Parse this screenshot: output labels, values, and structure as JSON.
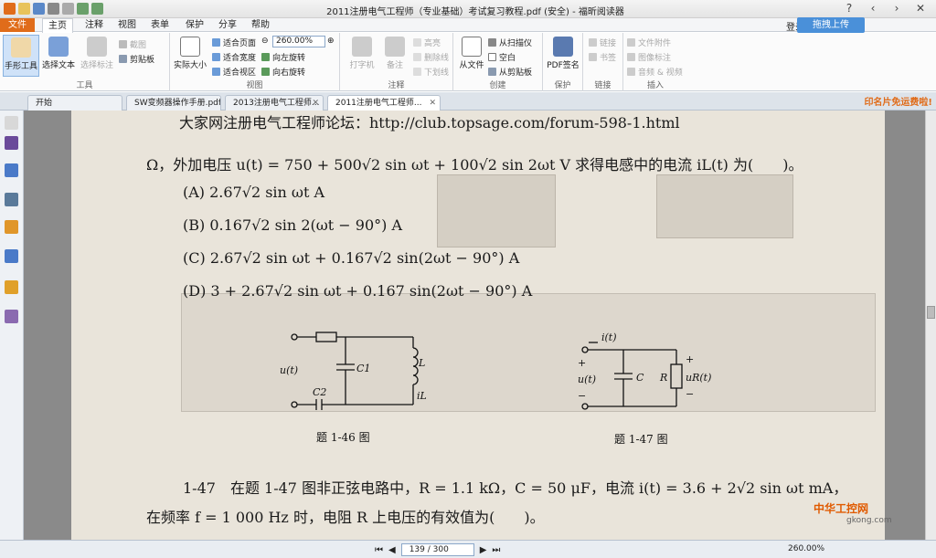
{
  "window": {
    "title": "2011注册电气工程师（专业基础）考试复习教程.pdf (安全) - 福昕阅读器",
    "controls": [
      "?",
      "‹",
      "›",
      "✕"
    ]
  },
  "menu": {
    "file": "文件",
    "items": [
      "主页",
      "注释",
      "视图",
      "表单",
      "保护",
      "分享",
      "帮助"
    ],
    "login": "登录",
    "upload": "拖拽上传"
  },
  "ribbon": {
    "tools": {
      "hand": "手形工具",
      "select_text": "选择文本",
      "select_annot": "选择标注",
      "label": "工具",
      "screenshot": "截图",
      "clipboard": "剪贴板"
    },
    "view": {
      "actual_size": "实际大小",
      "fit_page": "适合页面",
      "fit_width": "适合宽度",
      "fit_visible": "适合视区",
      "zoom": "260.00%",
      "rotate_left": "向左旋转",
      "rotate_right": "向右旋转",
      "label": "视图"
    },
    "comment": {
      "typewriter": "打字机",
      "note": "备注",
      "highlight": "高亮",
      "strikeout": "删除线",
      "underline": "下划线",
      "label": "注释"
    },
    "create": {
      "from_file": "从文件",
      "from_scanner": "从扫描仪",
      "blank": "空白",
      "from_clipboard": "从剪贴板",
      "label": "创建"
    },
    "protect": {
      "pdf_sign": "PDF签名",
      "label": "保护"
    },
    "links": {
      "link": "链接",
      "bookmark": "书签",
      "label": "链接"
    },
    "insert": {
      "attachment": "文件附件",
      "image": "图像标注",
      "audio_video": "音频 & 视频",
      "label": "插入"
    }
  },
  "tabs": [
    {
      "label": "开始"
    },
    {
      "label": "SW变频器操作手册.pdf"
    },
    {
      "label": "2013注册电气工程师..."
    },
    {
      "label": "2011注册电气工程师..."
    }
  ],
  "ad_text": "印名片免运费啦!",
  "document": {
    "lines": [
      "大家网注册电气工程师论坛：http://club.topsage.com/forum-598-1.html",
      "Ω，外加电压 u(t) = 750 + 500√2 sin ωt + 100√2 sin 2ωt V 求得电感中的电流 iL(t) 为(　　)。",
      "(A) 2.67√2 sin ωt  A",
      "(B) 0.167√2 sin 2(ωt − 90°)  A",
      "(C) 2.67√2 sin ωt + 0.167√2 sin(2ωt − 90°)  A",
      "(D) 3 + 2.67√2 sin ωt + 0.167 sin(2ωt − 90°)  A",
      "1-47　在题 1-47 图非正弦电路中，R = 1.1 kΩ，C = 50 μF，电流 i(t) = 3.6 + 2√2 sin ωt mA，",
      "在频率 f = 1 000 Hz 时，电阻 R 上电压的有效值为(　　)。"
    ],
    "fig46": {
      "caption": "题 1-46 图",
      "R": "R",
      "L": "L",
      "C1": "C1",
      "C2": "C2",
      "u": "u(t)",
      "iL": "iL(t)"
    },
    "fig47": {
      "caption": "题 1-47 图",
      "i": "i(t)",
      "u": "u(t)",
      "C": "C",
      "R": "R",
      "uR": "uR(t)",
      "plus": "+",
      "minus": "−"
    }
  },
  "status": {
    "page": "139 / 300",
    "zoom": "260.00%"
  },
  "watermark": {
    "brand": "中华工控网",
    "site": "gkong.com"
  }
}
